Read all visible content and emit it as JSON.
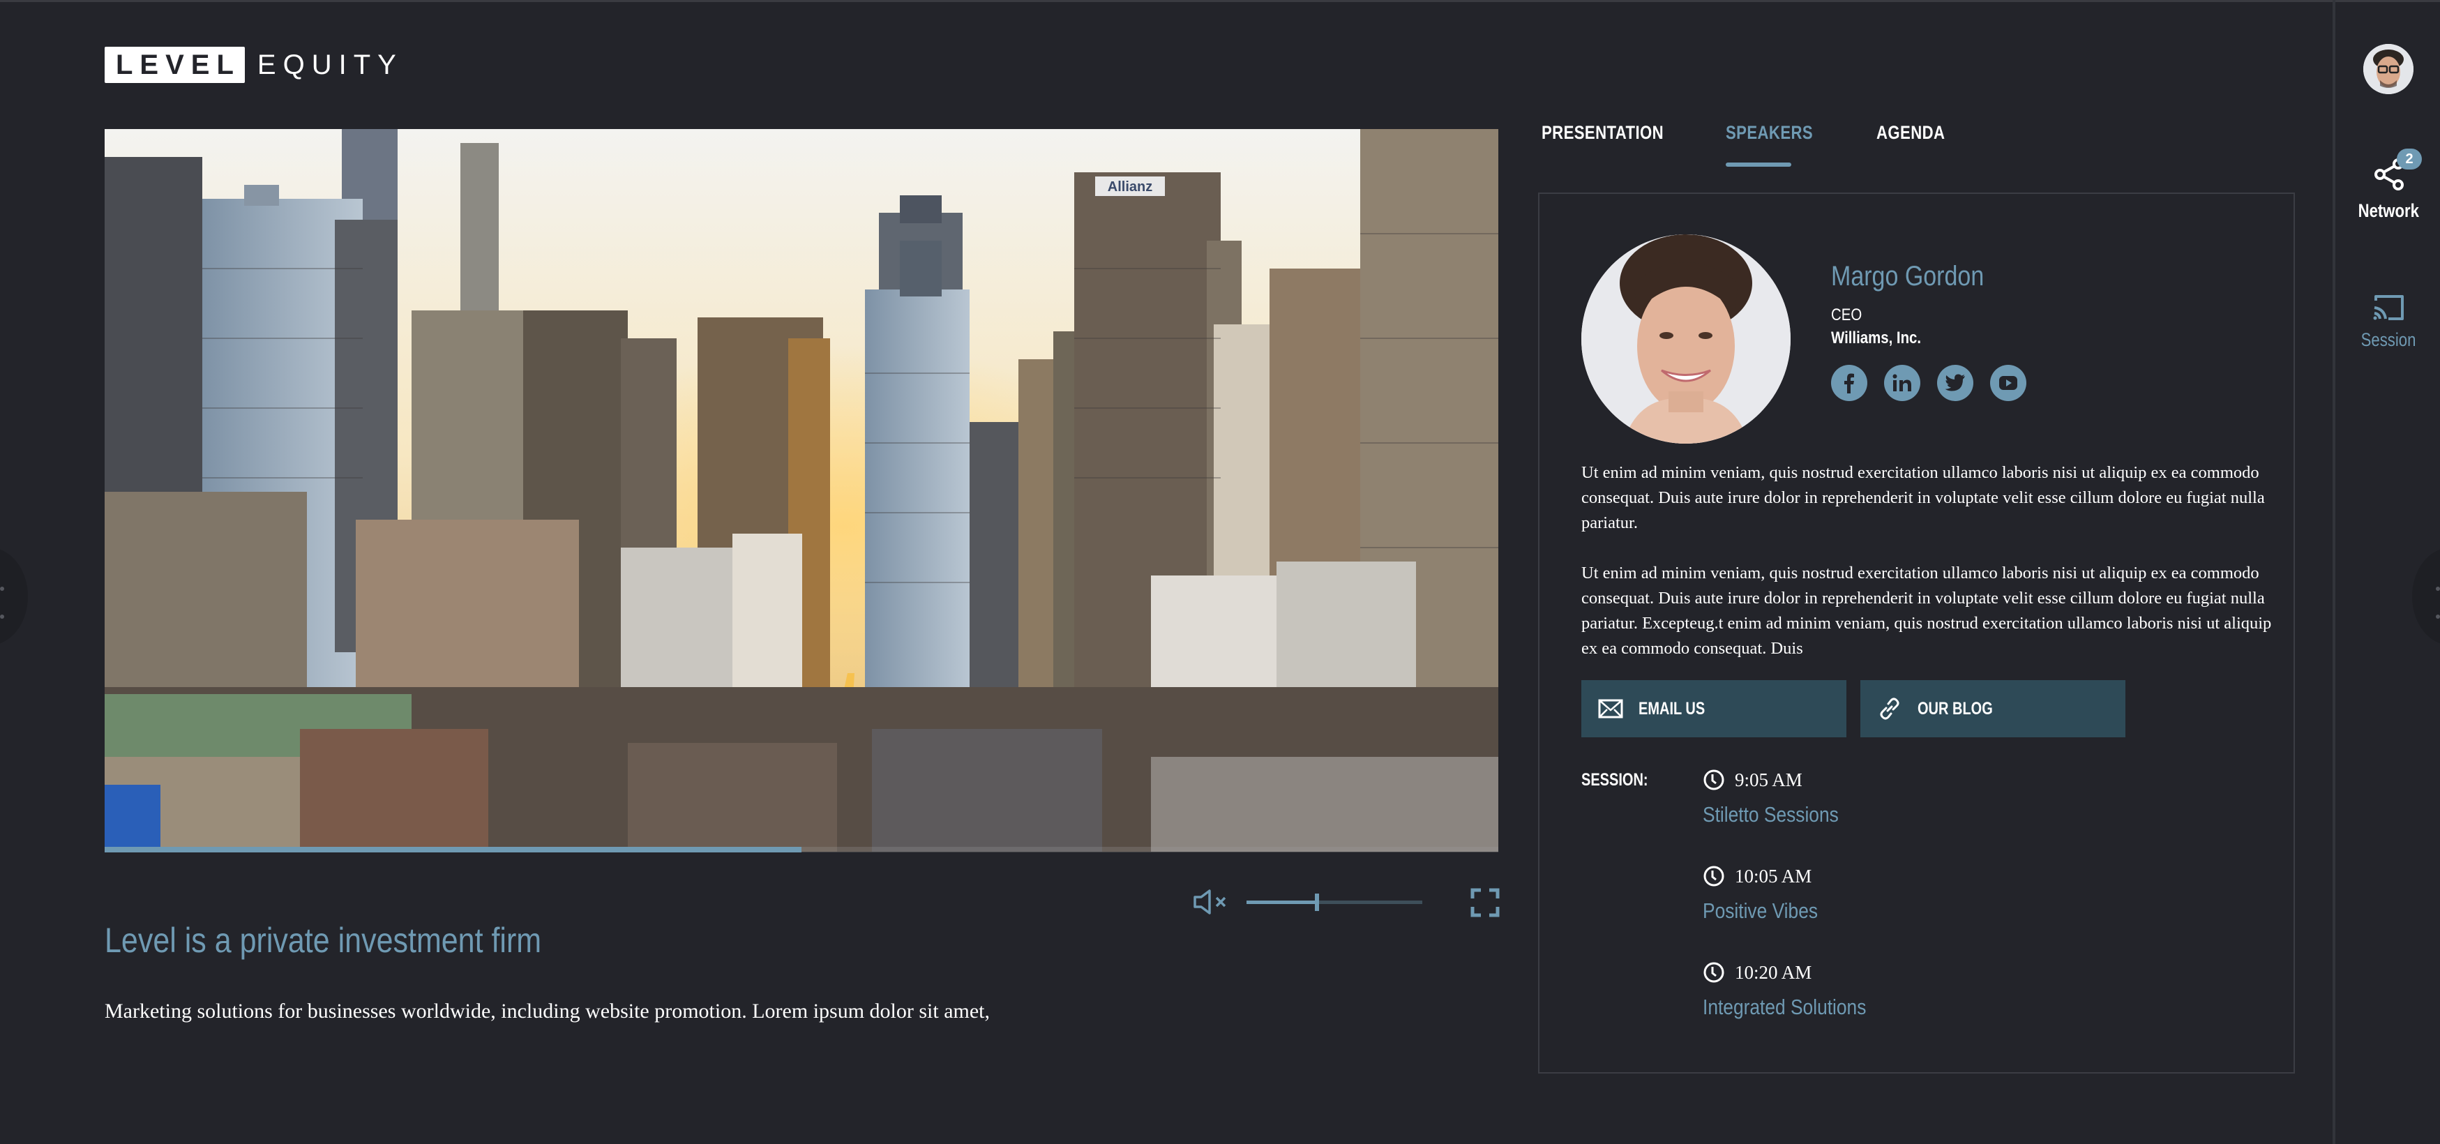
{
  "brand": {
    "logo_boxed": "LEVEL",
    "logo_text": "EQUITY"
  },
  "video": {
    "scene": "city-skyline-sunset",
    "sign_text": "Allianz",
    "progress_percent": 50,
    "volume_percent": 40,
    "muted": true,
    "mute_icon": "volume-mute-icon",
    "fullscreen_icon": "fullscreen-icon"
  },
  "main": {
    "headline": "Level is a private investment firm",
    "lead": "Marketing solutions for businesses worldwide, including website promotion. Lorem ipsum dolor sit amet,"
  },
  "tabs": [
    {
      "label": "PRESENTATION",
      "active": false
    },
    {
      "label": "SPEAKERS",
      "active": true
    },
    {
      "label": "AGENDA",
      "active": false
    }
  ],
  "speaker": {
    "name": "Margo Gordon",
    "title": "CEO",
    "company": "Williams, Inc.",
    "socials": [
      {
        "name": "facebook",
        "icon": "facebook-icon"
      },
      {
        "name": "linkedin",
        "icon": "linkedin-icon"
      },
      {
        "name": "twitter",
        "icon": "twitter-icon"
      },
      {
        "name": "youtube",
        "icon": "youtube-icon"
      }
    ],
    "bio": [
      "Ut enim ad minim veniam, quis nostrud exercitation ullamco laboris nisi ut aliquip ex ea commodo consequat. Duis aute irure dolor in reprehenderit in voluptate velit esse cillum dolore eu fugiat nulla pariatur.",
      "Ut enim ad minim veniam, quis nostrud exercitation ullamco laboris nisi ut aliquip ex ea commodo consequat. Duis aute irure dolor in reprehenderit in voluptate velit esse cillum dolore eu fugiat nulla pariatur. Excepteug.t enim ad minim veniam, quis nostrud exercitation ullamco laboris nisi ut aliquip ex ea commodo consequat. Duis"
    ],
    "buttons": {
      "email": "EMAIL US",
      "blog": "OUR BLOG"
    },
    "session_label": "SESSION:",
    "sessions": [
      {
        "time": "9:05 AM",
        "title": "Stiletto Sessions"
      },
      {
        "time": "10:05 AM",
        "title": "Positive Vibes"
      },
      {
        "time": "10:20 AM",
        "title": "Integrated Solutions"
      }
    ]
  },
  "rail": {
    "network_label": "Network",
    "network_badge": "2",
    "session_label": "Session"
  },
  "colors": {
    "background": "#23242a",
    "accent": "#6f9ab3",
    "button": "#2e4a57",
    "border": "#3b3d44"
  }
}
